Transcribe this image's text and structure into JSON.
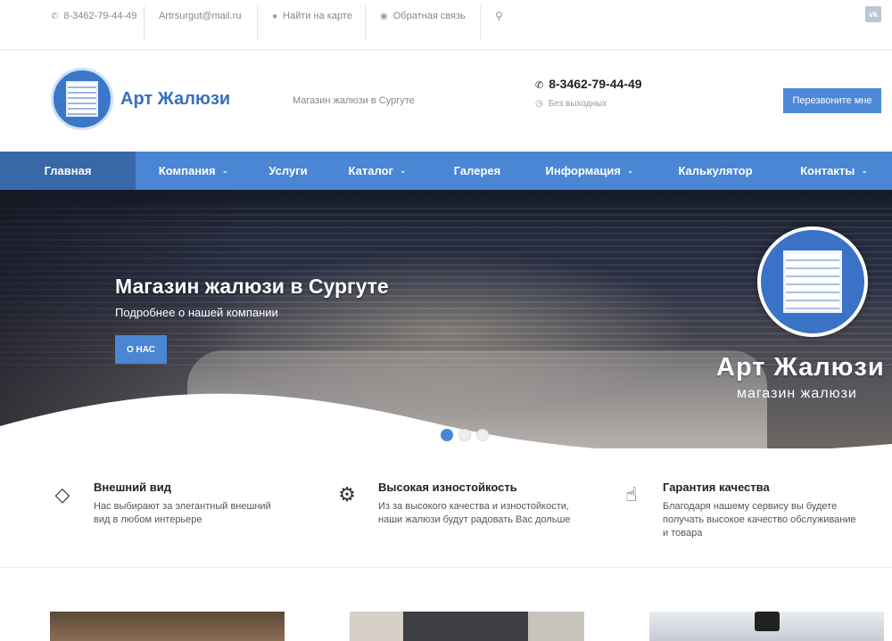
{
  "topbar": {
    "phone": "8-3462-79-44-49",
    "email": "Artrsurgut@mail.ru",
    "map_link": "Найти на карте",
    "feedback_link": "Обратная связь",
    "social": "vk"
  },
  "header": {
    "brand": "Арт Жалюзи",
    "tagline": "Магазин жалюзи в Сургуте",
    "phone": "8-3462-79-44-49",
    "hours": "Без выходных",
    "callback_label": "Перезвоните мне"
  },
  "nav": {
    "items": [
      {
        "label": "Главная",
        "active": true,
        "dropdown": false
      },
      {
        "label": "Компания",
        "dropdown": true
      },
      {
        "label": "Услуги",
        "dropdown": false
      },
      {
        "label": "Каталог",
        "dropdown": true
      },
      {
        "label": "Галерея",
        "dropdown": false
      },
      {
        "label": "Информация",
        "dropdown": true
      },
      {
        "label": "Калькулятор",
        "dropdown": false
      },
      {
        "label": "Контакты",
        "dropdown": true
      }
    ]
  },
  "hero": {
    "title": "Магазин жалюзи в Сургуте",
    "subtitle": "Подробнее о нашей компании",
    "button_label": "О НАС",
    "brand": "Арт Жалюзи",
    "brand_sub": "магазин жалюзи",
    "slides": 3,
    "active_slide": 1
  },
  "features": [
    {
      "icon": "diamond-icon",
      "title": "Внешний вид",
      "text": "Нас выбирают за элегантный внешний вид в любом интерьере"
    },
    {
      "icon": "gear-icon",
      "title": "Высокая изностойкость",
      "text": "Из за высокого качества и изностойкости, наши жалюзи будут радовать Вас дольше"
    },
    {
      "icon": "thumbs-up-icon",
      "title": "Гарантия качества",
      "text": "Благодаря нашему сервису вы будете получать высокое качество обслуживание и товара"
    }
  ],
  "colors": {
    "accent": "#4a86d3",
    "nav_active": "#3868a8",
    "brand_text": "#3a6fbd"
  }
}
